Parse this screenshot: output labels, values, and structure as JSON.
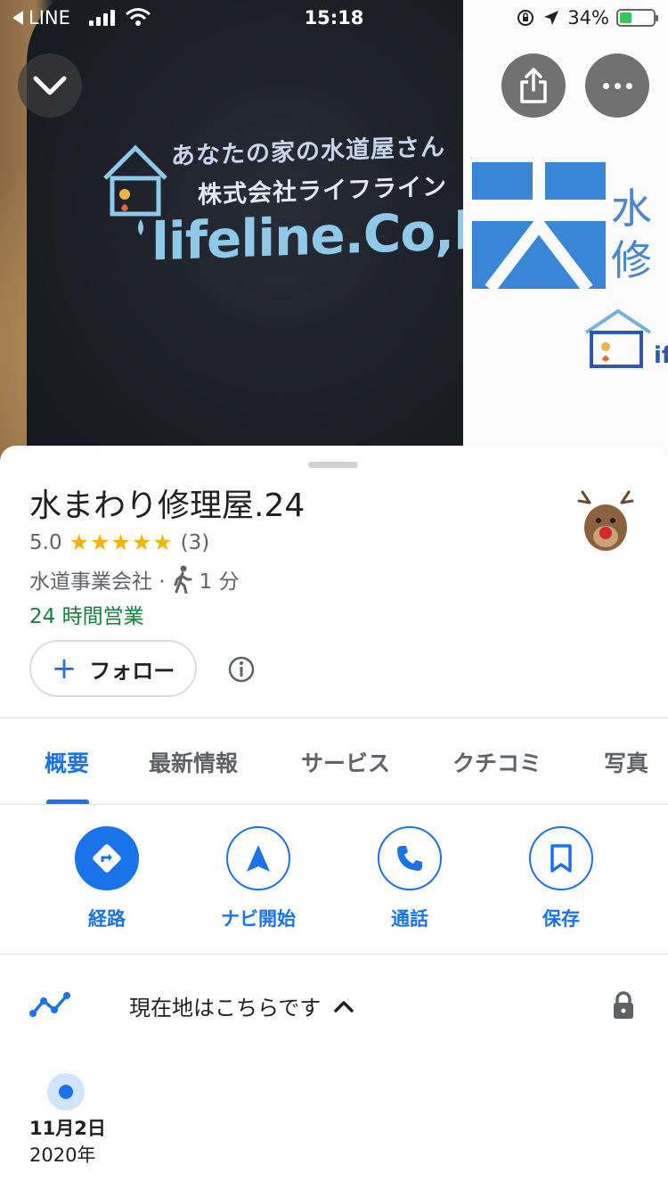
{
  "status_bar": {
    "back_app": "LINE",
    "time": "15:18",
    "battery": "34%"
  },
  "hero": {
    "main_photo_text_line1": "あなたの家の水道屋さん",
    "main_photo_text_line2": "株式会社ライフライン",
    "main_photo_text_line3": "lifeline.Co,ltd",
    "side_photo_text": "水\n修"
  },
  "place": {
    "name": "水まわり修理屋.24",
    "rating": "5.0",
    "stars": "★★★★★",
    "review_count": "(3)",
    "category": "水道事業会社 ·",
    "walk_time": "1 分",
    "open_status": "24 時間営業",
    "follow_label": "フォロー"
  },
  "tabs": [
    {
      "label": "概要",
      "active": true
    },
    {
      "label": "最新情報"
    },
    {
      "label": "サービス"
    },
    {
      "label": "クチコミ"
    },
    {
      "label": "写真"
    }
  ],
  "actions": [
    {
      "label": "経路",
      "icon": "directions-icon"
    },
    {
      "label": "ナビ開始",
      "icon": "navigation-icon"
    },
    {
      "label": "通話",
      "icon": "phone-icon"
    },
    {
      "label": "保存",
      "icon": "bookmark-icon"
    }
  ],
  "timeline": {
    "label": "現在地はこちらです",
    "date_day": "11月2日",
    "date_year": "2020年"
  },
  "colors": {
    "accent": "#1a73e8",
    "open_green": "#188038",
    "star": "#f4b400"
  }
}
